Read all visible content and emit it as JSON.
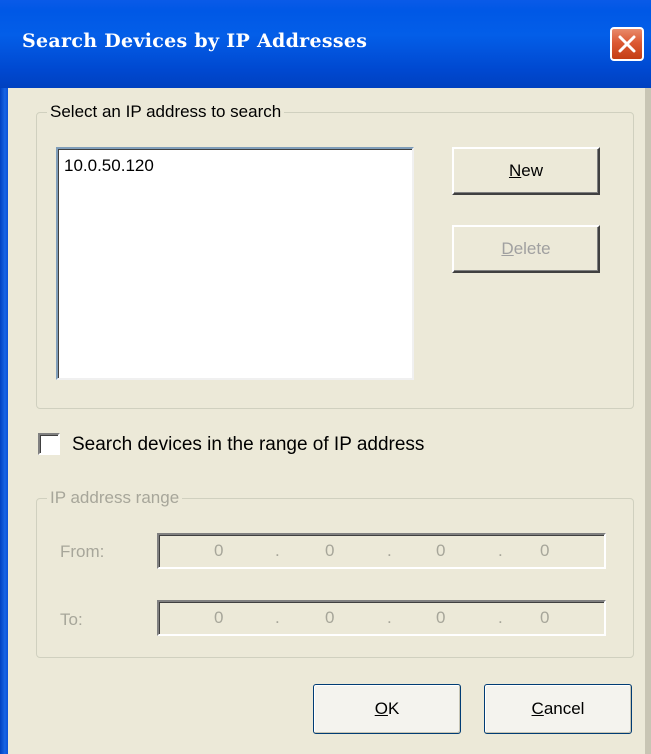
{
  "window": {
    "title": "Search Devices by IP Addresses",
    "title_color": "#0058e6"
  },
  "icons": {
    "close": "close-x-icon"
  },
  "select_group": {
    "legend": "Select an IP address to search",
    "list_items": [
      "10.0.50.120"
    ],
    "new_button": {
      "prefix": "",
      "mnemonic": "N",
      "rest": "ew"
    },
    "delete_button": {
      "prefix": "",
      "mnemonic": "D",
      "rest": "elete",
      "enabled": false
    }
  },
  "range_checkbox": {
    "label": "Search devices in the range of IP address",
    "checked": false
  },
  "range_group": {
    "legend": "IP address range",
    "enabled": false,
    "from": {
      "label": "From:",
      "octets": [
        "0",
        "0",
        "0",
        "0"
      ]
    },
    "to": {
      "label": "To:",
      "octets": [
        "0",
        "0",
        "0",
        "0"
      ]
    },
    "separator": "."
  },
  "footer": {
    "ok_button": {
      "prefix": "",
      "mnemonic": "O",
      "rest": "K"
    },
    "cancel_button": {
      "prefix": "",
      "mnemonic": "C",
      "rest": "ancel"
    }
  }
}
